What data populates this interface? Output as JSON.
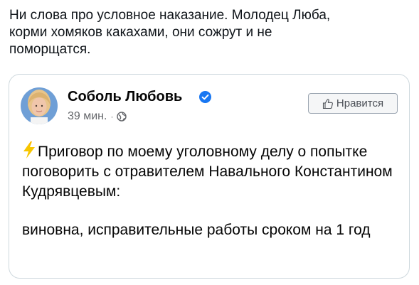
{
  "tweet": {
    "text": "Ни слова про условное наказание. Молодец Люба,\nкорми хомяков какахами, они сожрут и не\nпоморщатся."
  },
  "post": {
    "author_name": "Соболь Любовь",
    "time": "39 мин.",
    "separator": "·",
    "like_label": "Нравится",
    "line1": "Приговор по моему уголовному делу о попытке поговорить с отравителем Навального Константином Кудрявцевым:",
    "line2": "виновна, исправительные работы сроком на 1 год",
    "icons": {
      "verified": "verified-badge-icon",
      "globe": "globe-icon",
      "like": "thumbs-up-icon",
      "lightning": "lightning-bolt-icon"
    }
  },
  "colors": {
    "verified_blue": "#1877f2",
    "meta_gray": "#65676b",
    "bolt_yellow": "#f7c600"
  }
}
